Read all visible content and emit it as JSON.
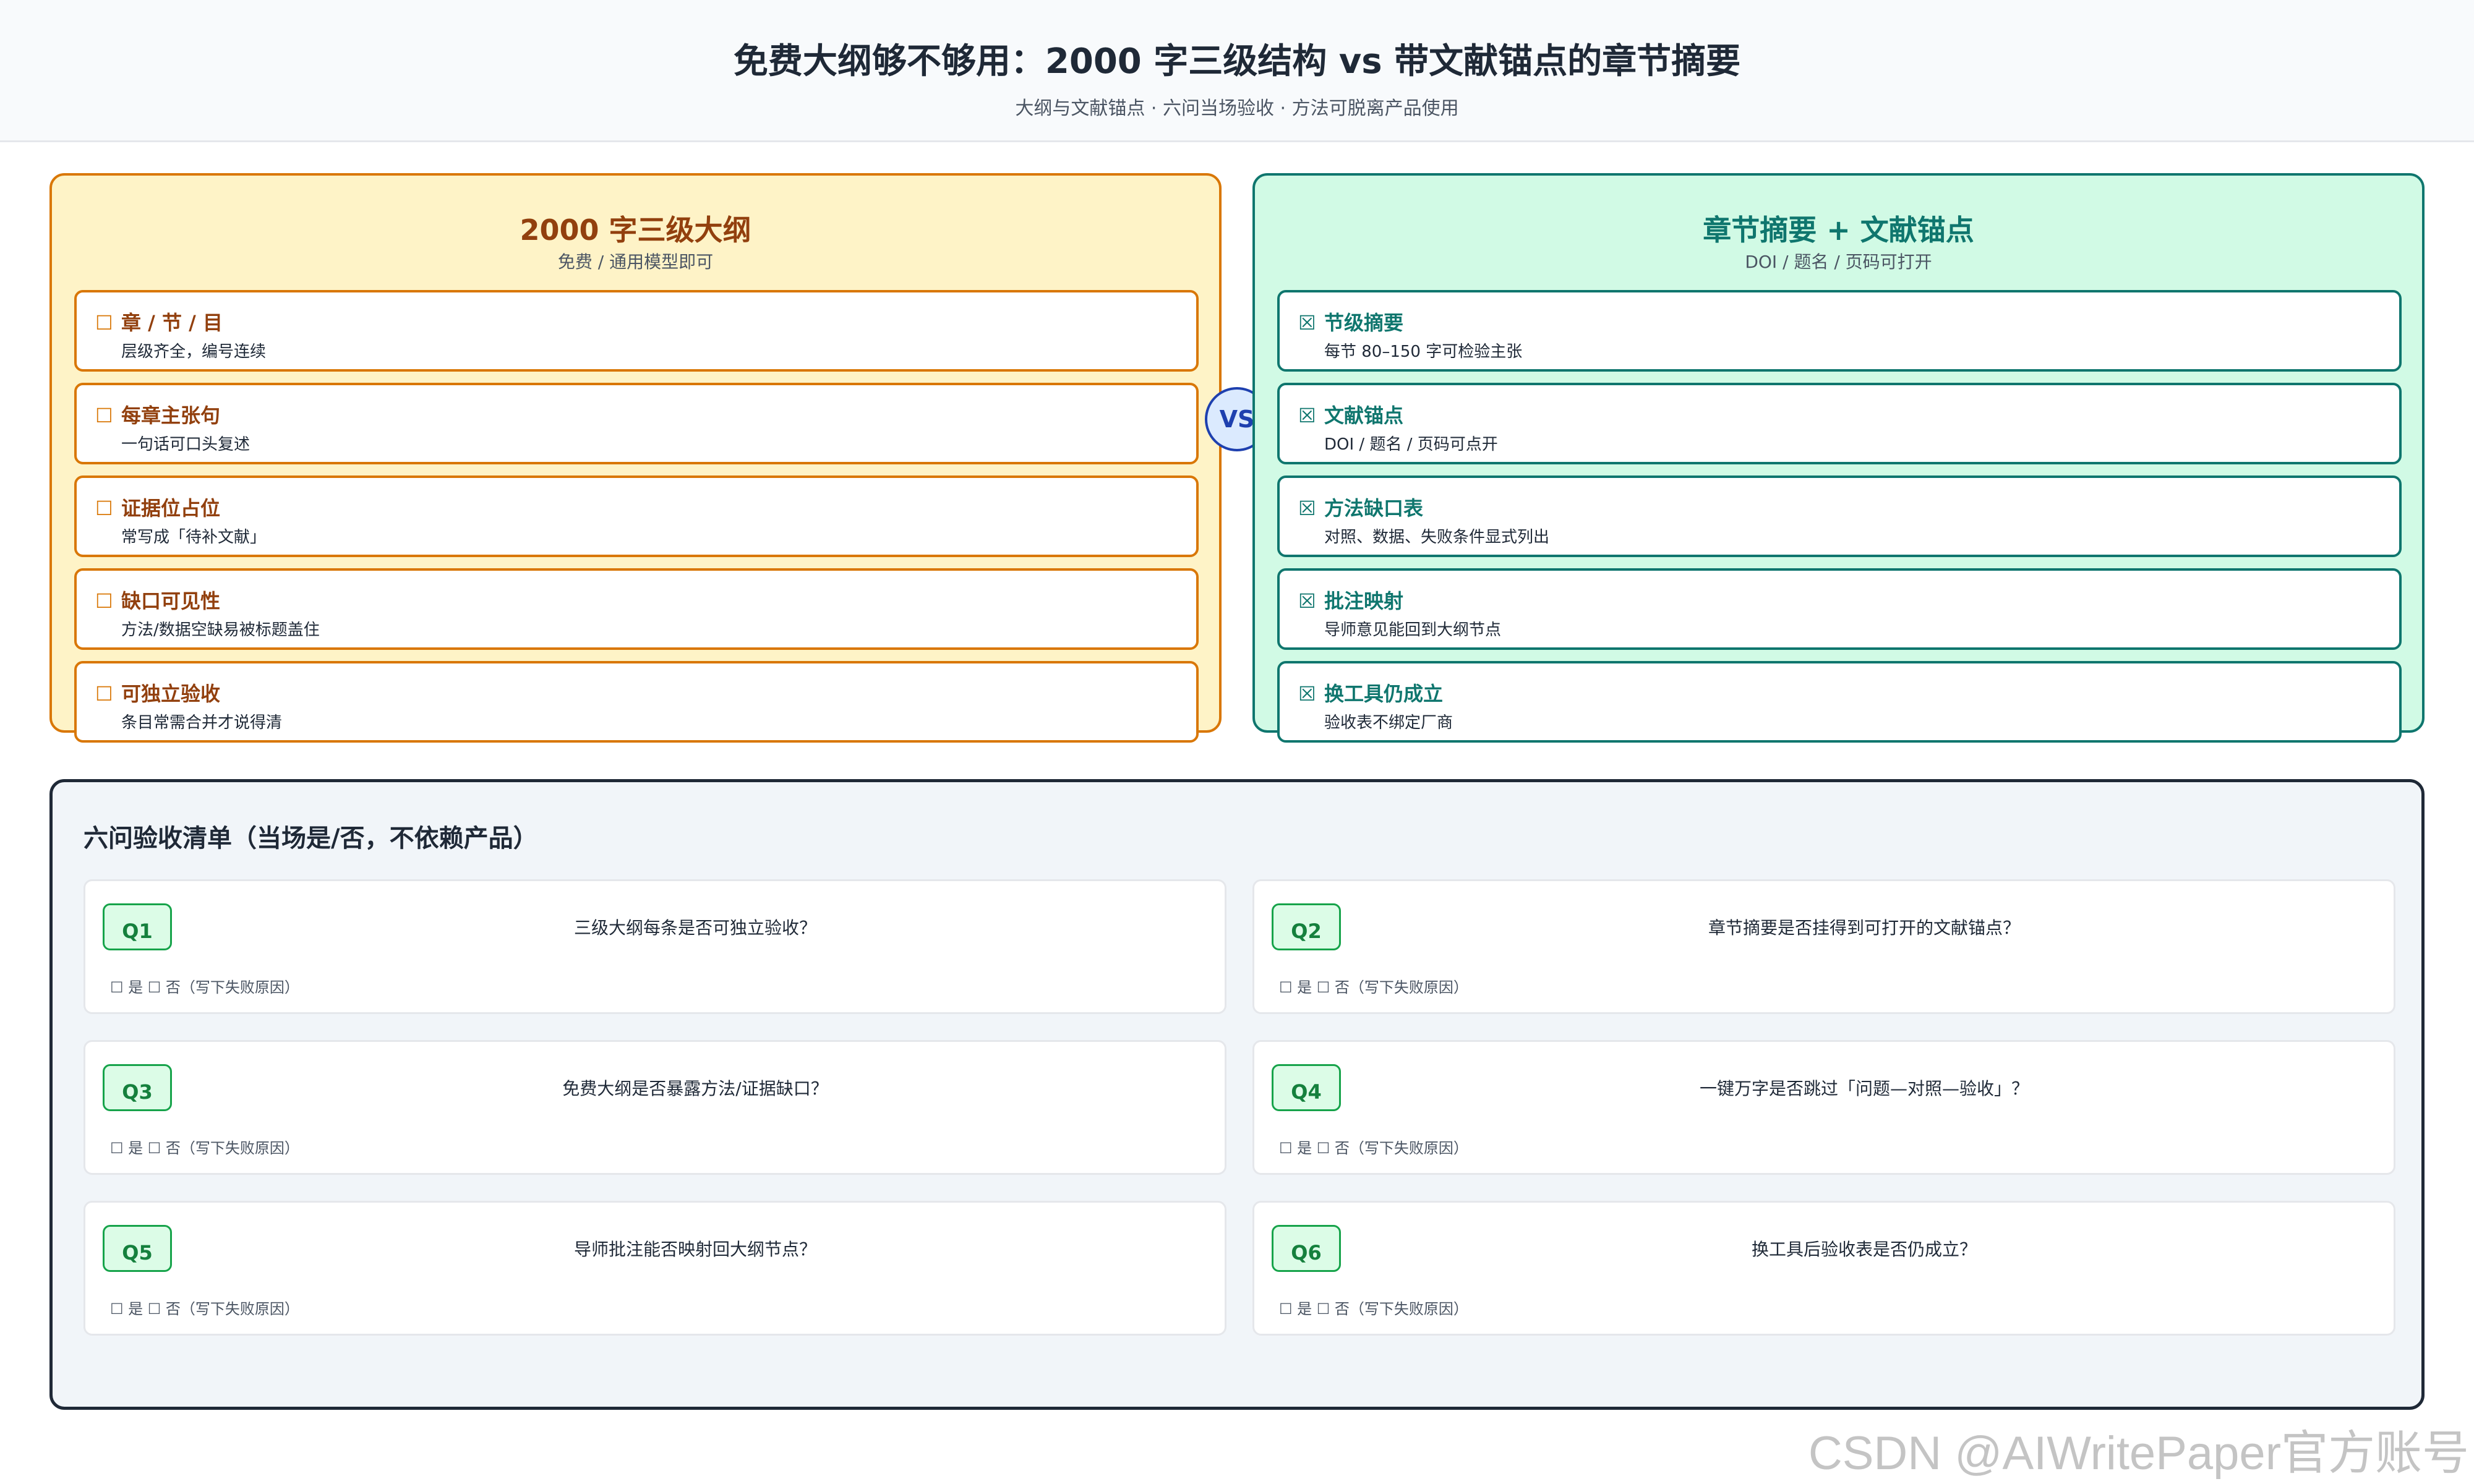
{
  "header": {
    "title": "免费大纲够不够用：2000 字三级结构 vs 带文献锚点的章节摘要",
    "subtitle": "大纲与文献锚点 · 六问当场验收 · 方法可脱离产品使用"
  },
  "left_panel": {
    "title": "2000 字三级大纲",
    "subtitle": "免费 / 通用模型即可",
    "checkbox_symbol": "☐",
    "items": [
      {
        "title": "章 / 节 / 目",
        "desc": "层级齐全，编号连续"
      },
      {
        "title": "每章主张句",
        "desc": "一句话可口头复述"
      },
      {
        "title": "证据位占位",
        "desc": "常写成「待补文献」"
      },
      {
        "title": "缺口可见性",
        "desc": "方法/数据空缺易被标题盖住"
      },
      {
        "title": "可独立验收",
        "desc": "条目常需合并才说得清"
      }
    ]
  },
  "vs_label": "VS",
  "right_panel": {
    "title": "章节摘要 + 文献锚点",
    "subtitle": "DOI / 题名 / 页码可打开",
    "checkbox_symbol": "☒",
    "items": [
      {
        "title": "节级摘要",
        "desc": "每节 80–150 字可检验主张"
      },
      {
        "title": "文献锚点",
        "desc": "DOI / 题名 / 页码可点开"
      },
      {
        "title": "方法缺口表",
        "desc": "对照、数据、失败条件显式列出"
      },
      {
        "title": "批注映射",
        "desc": "导师意见能回到大纲节点"
      },
      {
        "title": "换工具仍成立",
        "desc": "验收表不绑定厂商"
      }
    ]
  },
  "checklist": {
    "title": "六问验收清单（当场是/否，不依赖产品）",
    "options": "☐ 是   ☐ 否（写下失败原因）",
    "questions": [
      {
        "id": "Q1",
        "text": "三级大纲每条是否可独立验收？"
      },
      {
        "id": "Q2",
        "text": "章节摘要是否挂得到可打开的文献锚点？"
      },
      {
        "id": "Q3",
        "text": "免费大纲是否暴露方法/证据缺口？"
      },
      {
        "id": "Q4",
        "text": "一键万字是否跳过「问题—对照—验收」？"
      },
      {
        "id": "Q5",
        "text": "导师批注能否映射回大纲节点？"
      },
      {
        "id": "Q6",
        "text": "换工具后验收表是否仍成立？"
      }
    ]
  },
  "watermark": "CSDN @AIWritePaper官方账号"
}
